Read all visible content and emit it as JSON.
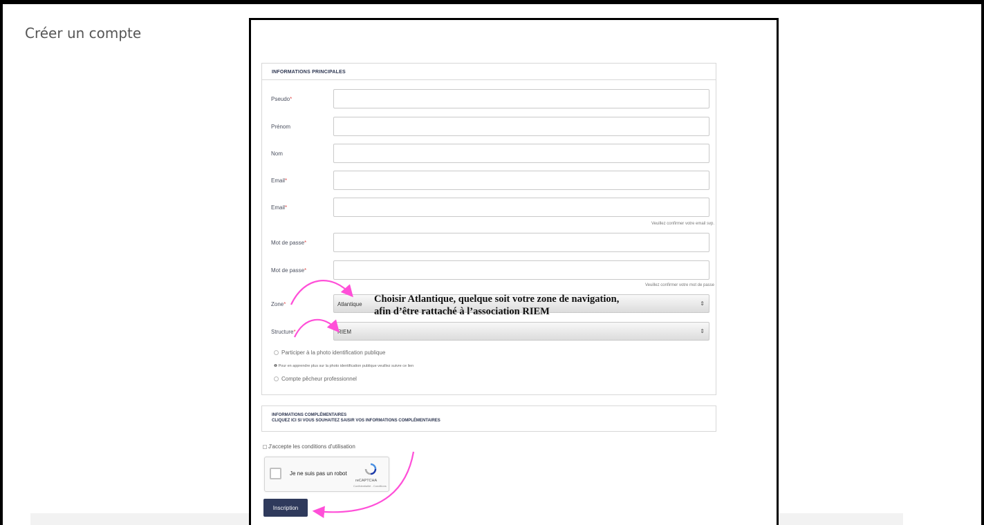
{
  "page": {
    "title": "Créer un compte"
  },
  "main_section": {
    "header": "INFORMATIONS PRINCIPALES",
    "fields": [
      {
        "label": "Pseudo",
        "required": true
      },
      {
        "label": "Prénom",
        "required": false
      },
      {
        "label": "Nom",
        "required": false
      },
      {
        "label": "Email",
        "required": true
      },
      {
        "label": "Email",
        "required": true,
        "hint": "Veuillez confirmer votre email svp."
      },
      {
        "label": "Mot de passe",
        "required": true
      },
      {
        "label": "Mot de passe",
        "required": true,
        "hint": "Veuillez confirmer votre mot de passe"
      }
    ],
    "zone": {
      "label": "Zone",
      "required": true,
      "value": "Atlantique"
    },
    "structure": {
      "label": "Structure",
      "required": true,
      "value": "RIEM"
    },
    "required_mark": "*",
    "photo_option": "Participer à la photo identification publique",
    "photo_info": "Pour en apprendre plus sur la photo identification publique veuillez suivre ce lien",
    "pro_option": "Compte pêcheur professionnel"
  },
  "extra_section": {
    "title": "INFORMATIONS COMPLÉMENTAIRES",
    "subtitle": "CLIQUEZ ICI SI VOUS SOUHAITEZ SAISIR VOS INFORMATIONS COMPLÉMENTAIRES"
  },
  "terms": {
    "label": "J'accepte les conditions d'utilisation"
  },
  "recaptcha": {
    "label": "Je ne suis pas un robot",
    "brand": "reCAPTCHA",
    "links": "Confidentialité - Conditions"
  },
  "submit": {
    "label": "Inscription"
  },
  "annotation": {
    "line1": "Choisir Atlantique, quelque soit votre zone de navigation,",
    "line2": "afin d’être rattaché à l’association RIEM"
  },
  "colors": {
    "accent": "#2f3a5c",
    "arrow": "#ff4fd8",
    "required": "#e05050"
  }
}
